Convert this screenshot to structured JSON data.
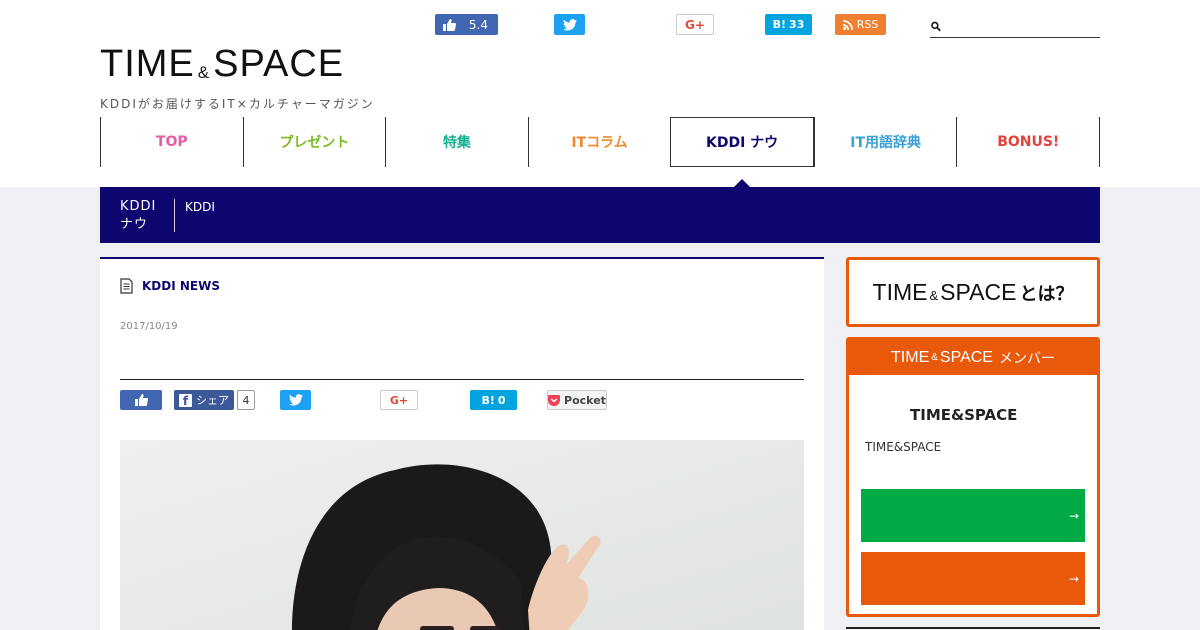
{
  "header": {
    "logo_main": "TIME",
    "logo_amp": "&",
    "logo_main2": "SPACE",
    "logo_sub": "KDDIがお届けするIT×カルチャーマガジン"
  },
  "top_share": {
    "like_count": "5.4",
    "gplus_label": "G+",
    "hatena_label": "B!",
    "hatena_count": "33",
    "rss_label": "RSS"
  },
  "search": {
    "placeholder": ""
  },
  "nav": {
    "items": [
      {
        "label": "TOP",
        "color": "#e95aa2"
      },
      {
        "label": "プレゼント",
        "color": "#7bbb23"
      },
      {
        "label": "特集",
        "color": "#16b08e"
      },
      {
        "label": "ITコラム",
        "color": "#ee8a2c"
      },
      {
        "label": "KDDI ナウ",
        "color": "#0e0770"
      },
      {
        "label": "IT用語辞典",
        "color": "#3aa0d8"
      },
      {
        "label": "BONUS!",
        "color": "#e3413b"
      }
    ],
    "active_index": 4
  },
  "category": {
    "label_line1": "KDDI",
    "label_line2": "ナウ",
    "breadcrumb": "KDDI"
  },
  "article": {
    "section": "KDDI NEWS",
    "date": "2017/10/19"
  },
  "article_share": {
    "fb_label": "シェア",
    "fb_count": "4",
    "gplus_label": "G+",
    "hatena_label": "B!",
    "hatena_count": "0",
    "pocket_label": "Pocket"
  },
  "sidebar": {
    "about_title": "TIME",
    "about_amp": "&",
    "about_title2": "SPACE",
    "about_tail": "とは？",
    "member_head": "TIME",
    "member_amp": "&",
    "member_head2": "SPACE",
    "member_head_jp": "メンバー",
    "member_title": "TIME&SPACE",
    "member_desc": "TIME&SPACE",
    "cta_arrow": "→"
  },
  "colors": {
    "navy": "#0e0770",
    "orange": "#e8590c",
    "green": "#00ab44"
  }
}
